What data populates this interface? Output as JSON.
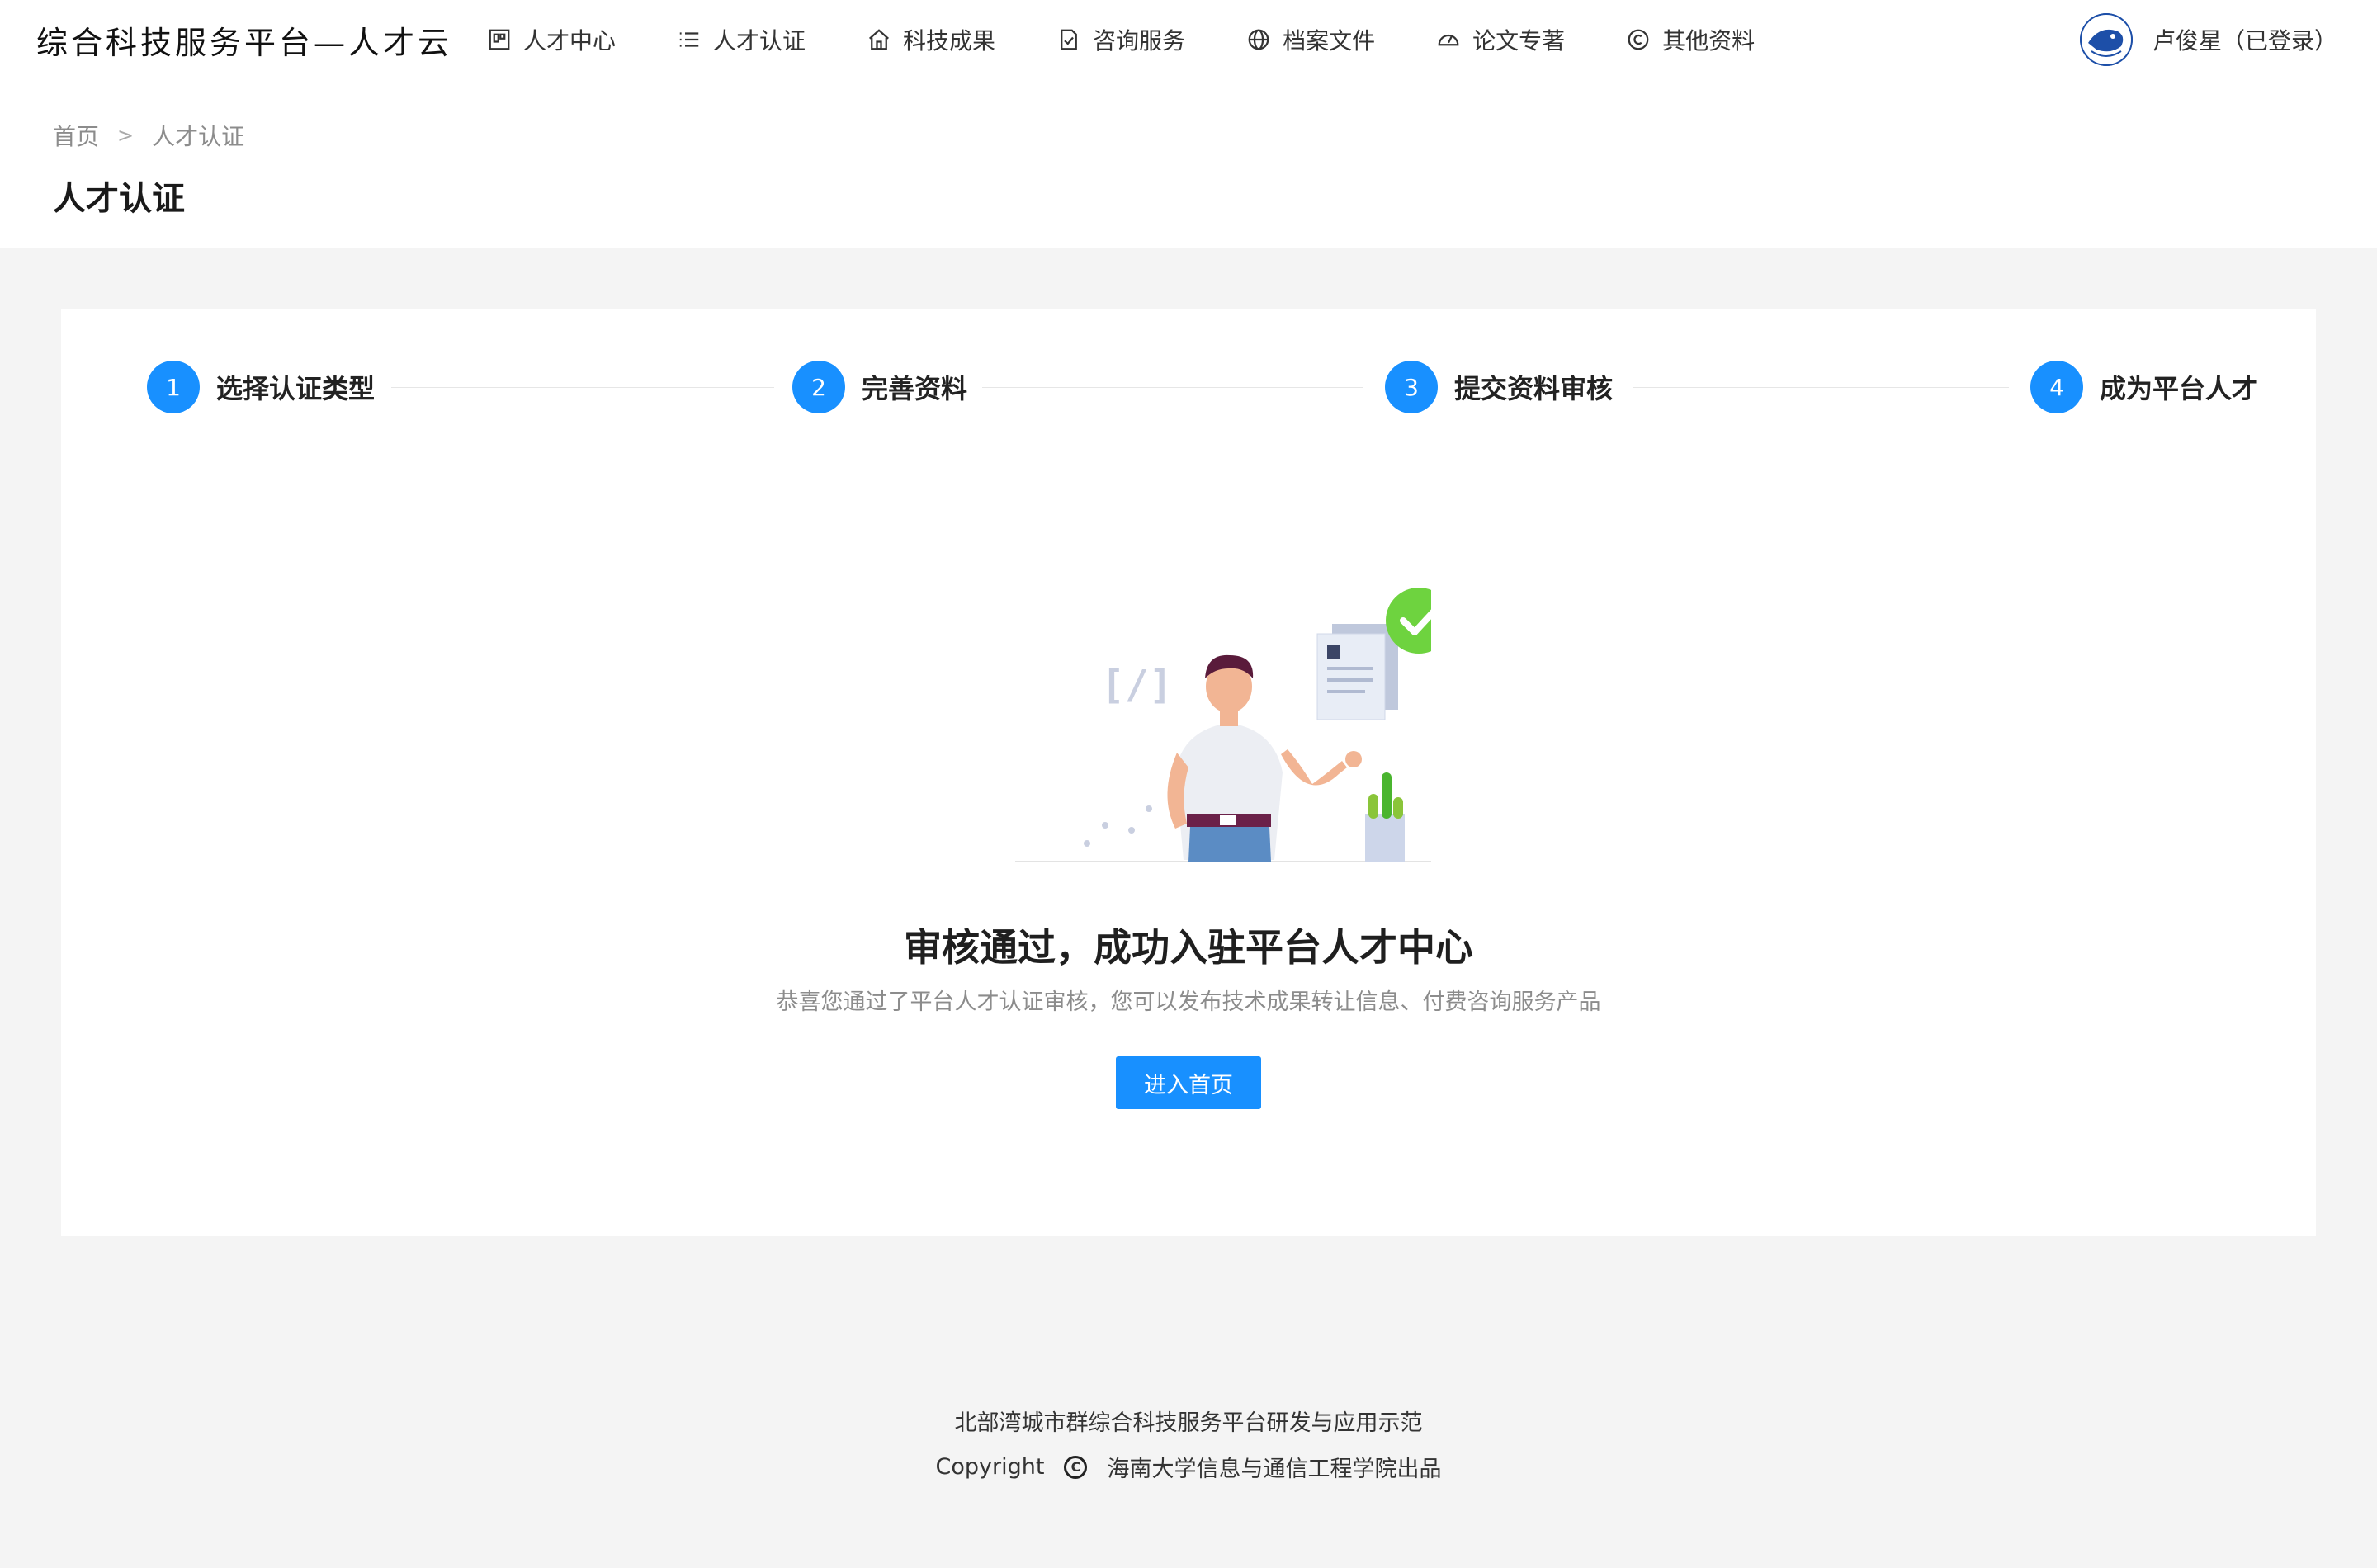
{
  "header": {
    "logo": "综合科技服务平台—人才云",
    "nav": [
      {
        "label": "人才中心",
        "icon": "board-icon"
      },
      {
        "label": "人才认证",
        "icon": "list-icon"
      },
      {
        "label": "科技成果",
        "icon": "home-icon"
      },
      {
        "label": "咨询服务",
        "icon": "doc-check-icon"
      },
      {
        "label": "档案文件",
        "icon": "globe-icon"
      },
      {
        "label": "论文专著",
        "icon": "dashboard-icon"
      },
      {
        "label": "其他资料",
        "icon": "copyright-icon"
      }
    ],
    "user_name": "卢俊星（已登录）"
  },
  "breadcrumb": {
    "home": "首页",
    "current": "人才认证"
  },
  "page_title": "人才认证",
  "steps": [
    {
      "num": "1",
      "label": "选择认证类型"
    },
    {
      "num": "2",
      "label": "完善资料"
    },
    {
      "num": "3",
      "label": "提交资料审核"
    },
    {
      "num": "4",
      "label": "成为平台人才"
    }
  ],
  "result": {
    "title": "审核通过，成功入驻平台人才中心",
    "subtitle": "恭喜您通过了平台人才认证审核，您可以发布技术成果转让信息、付费咨询服务产品",
    "button": "进入首页"
  },
  "footer": {
    "line1": "北部湾城市群综合科技服务平台研发与应用示范",
    "copyright": "Copyright",
    "org": "海南大学信息与通信工程学院出品"
  },
  "colors": {
    "primary": "#1890ff",
    "success": "#52c41a",
    "background": "#f4f4f4"
  }
}
